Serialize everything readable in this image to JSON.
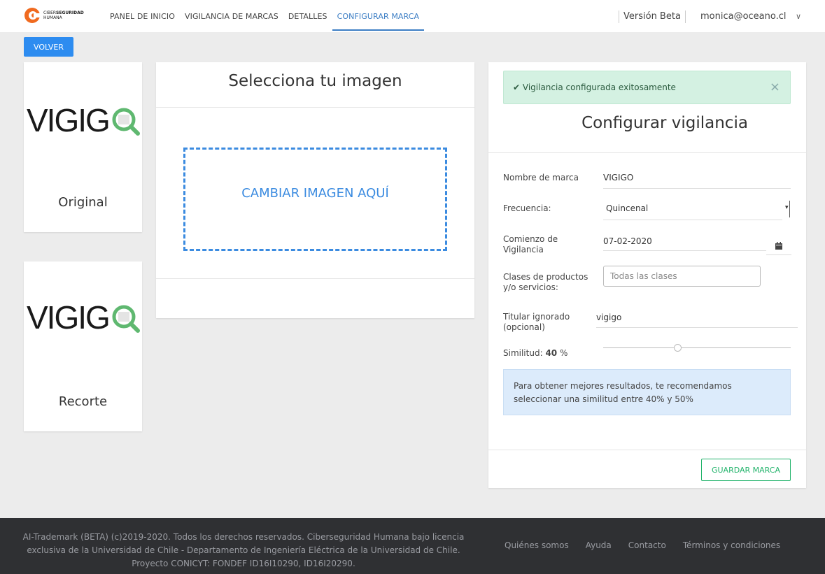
{
  "nav": {
    "logo_line1_a": "CIBER",
    "logo_line1_b": "SEGURIDAD",
    "logo_line2": "HUMANA",
    "items": [
      {
        "label": "PANEL DE INICIO"
      },
      {
        "label": "VIGILANCIA DE MARCAS"
      },
      {
        "label": "DETALLES"
      },
      {
        "label": "CONFIGURAR MARCA"
      }
    ],
    "beta": "Versión Beta",
    "user": "monica@oceano.cl"
  },
  "volver_label": "VOLVER",
  "left": {
    "logo_text": "VIGIG",
    "original_label": "Original",
    "recorte_label": "Recorte"
  },
  "upload": {
    "title": "Selecciona tu imagen",
    "dropzone_label": "CAMBIAR IMAGEN AQUÍ"
  },
  "config": {
    "alert": "Vigilancia configurada exitosamente",
    "title": "Configurar vigilancia",
    "fields": {
      "nombre_label": "Nombre de marca",
      "nombre_value": "VIGIGO",
      "frecuencia_label": "Frecuencia:",
      "frecuencia_value": "Quincenal",
      "comienzo_label_1": "Comienzo de",
      "comienzo_label_2": "Vigilancia",
      "comienzo_value": "07-02-2020",
      "clases_label_1": "Clases de productos",
      "clases_label_2": "y/o servicios:",
      "clases_placeholder": "Todas las clases",
      "titular_label_1": "Titular ignorado",
      "titular_label_2": "(opcional)",
      "titular_value": "vigigo",
      "similitud_label": "Similitud:",
      "similitud_value": "40",
      "similitud_unit": "%"
    },
    "info": "Para obtener mejores resultados, te recomendamos seleccionar una similitud entre 40% y 50%",
    "save_label": "GUARDAR MARCA"
  },
  "colors": {
    "accent": "#3b7dc4",
    "primary_button": "#2d8cf0",
    "success": "#22b36b",
    "logo_green": "#5fb870"
  },
  "footer": {
    "text": "AI-Trademark (BETA) (c)2019-2020. Todos los derechos reservados. Ciberseguridad Humana bajo licencia exclusiva de la Universidad de Chile - Departamento de Ingeniería Eléctrica de la Universidad de Chile. Proyecto CONICYT: FONDEF ID16I10290, ID16I20290.",
    "links": [
      {
        "label": "Quiénes somos"
      },
      {
        "label": "Ayuda"
      },
      {
        "label": "Contacto"
      },
      {
        "label": "Términos y condiciones"
      }
    ]
  }
}
